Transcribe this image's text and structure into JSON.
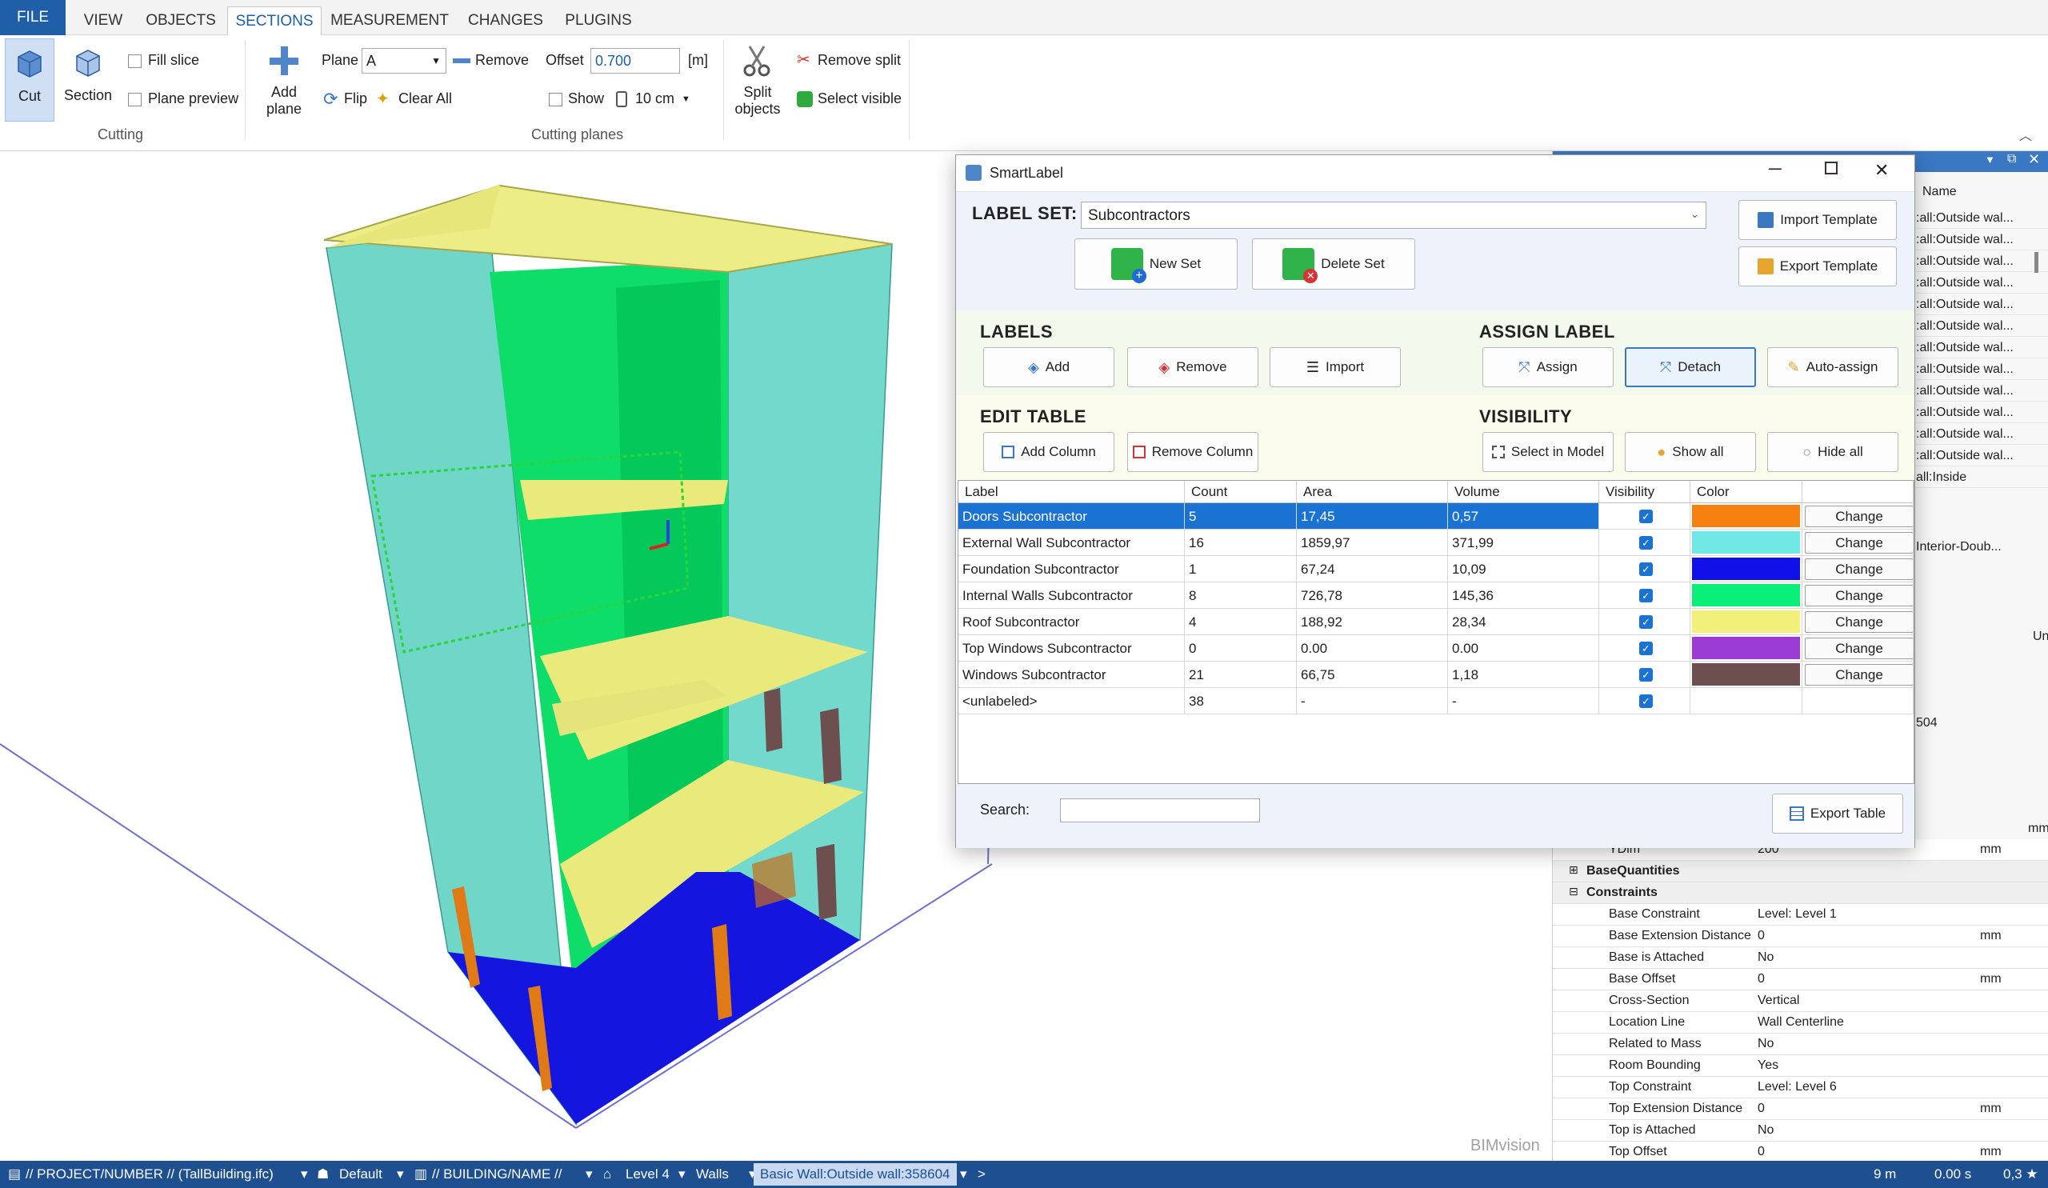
{
  "ribbon": {
    "tabs": [
      "FILE",
      "VIEW",
      "OBJECTS",
      "SECTIONS",
      "MEASUREMENT",
      "CHANGES",
      "PLUGINS"
    ],
    "active_tab": "SECTIONS",
    "cut_label": "Cut",
    "section_label": "Section",
    "fill_slice_label": "Fill slice",
    "plane_preview_label": "Plane preview",
    "cutting_group_label": "Cutting",
    "add_plane_label": "Add",
    "add_plane_label2": "plane",
    "plane_label": "Plane",
    "plane_value": "A",
    "remove_label": "Remove",
    "flip_label": "Flip",
    "clear_all_label": "Clear All",
    "offset_label": "Offset",
    "offset_value": "0.700",
    "offset_unit": "[m]",
    "show_label": "Show",
    "step_value": "10 cm",
    "cutting_planes_group_label": "Cutting planes",
    "split_objects_label": "Split",
    "split_objects_label2": "objects",
    "remove_split_label": "Remove split",
    "select_visible_label": "Select visible"
  },
  "viewport": {
    "watermark": "BIMvision"
  },
  "dock": {
    "name_header": "Name",
    "name_items": [
      ":all:Outside wal...",
      ":all:Outside wal...",
      ":all:Outside wal...",
      ":all:Outside wal...",
      ":all:Outside wal...",
      ":all:Outside wal...",
      ":all:Outside wal...",
      ":all:Outside wal...",
      ":all:Outside wal...",
      ":all:Outside wal...",
      ":all:Outside wal...",
      ":all:Outside wal...",
      "all:Inside"
    ],
    "interior_item": "Interior-Doub...",
    "unit_header": "Unit",
    "fragment_value": "504",
    "ydim_label": "YDim",
    "ydim_value": "200",
    "ydim_unit": "mm",
    "prev_unit": "mm",
    "base_quantities": "BaseQuantities",
    "constraints": "Constraints",
    "properties": [
      {
        "name": "Base Constraint",
        "value": "Level: Level 1",
        "unit": ""
      },
      {
        "name": "Base Extension Distance",
        "value": "0",
        "unit": "mm"
      },
      {
        "name": "Base is Attached",
        "value": "No",
        "unit": ""
      },
      {
        "name": "Base Offset",
        "value": "0",
        "unit": "mm"
      },
      {
        "name": "Cross-Section",
        "value": "Vertical",
        "unit": ""
      },
      {
        "name": "Location Line",
        "value": "Wall Centerline",
        "unit": ""
      },
      {
        "name": "Related to Mass",
        "value": "No",
        "unit": ""
      },
      {
        "name": "Room Bounding",
        "value": "Yes",
        "unit": ""
      },
      {
        "name": "Top Constraint",
        "value": "Level: Level 6",
        "unit": ""
      },
      {
        "name": "Top Extension Distance",
        "value": "0",
        "unit": "mm"
      },
      {
        "name": "Top is Attached",
        "value": "No",
        "unit": ""
      },
      {
        "name": "Top Offset",
        "value": "0",
        "unit": "mm"
      }
    ]
  },
  "dialog": {
    "title": "SmartLabel",
    "label_set_label": "LABEL SET:",
    "label_set_value": "Subcontractors",
    "import_template": "Import Template",
    "export_template": "Export Template",
    "new_set": "New Set",
    "delete_set": "Delete Set",
    "labels_header": "LABELS",
    "add": "Add",
    "remove": "Remove",
    "import": "Import",
    "assign_header": "ASSIGN LABEL",
    "assign": "Assign",
    "detach": "Detach",
    "auto_assign": "Auto-assign",
    "edit_table_header": "EDIT TABLE",
    "add_column": "Add Column",
    "remove_column": "Remove Column",
    "visibility_header": "VISIBILITY",
    "select_in_model": "Select in Model",
    "show_all": "Show all",
    "hide_all": "Hide all",
    "columns": [
      "Label",
      "Count",
      "Area",
      "Volume",
      "Visibility",
      "Color"
    ],
    "change_label": "Change",
    "rows": [
      {
        "label": "Doors Subcontractor",
        "count": "5",
        "area": "17,45",
        "volume": "0,57",
        "color": "#f57f0f",
        "selected": true
      },
      {
        "label": "External Wall Subcontractor",
        "count": "16",
        "area": "1859,97",
        "volume": "371,99",
        "color": "#6fe8e6",
        "selected": false
      },
      {
        "label": "Foundation Subcontractor",
        "count": "1",
        "area": "67,24",
        "volume": "10,09",
        "color": "#1010e8",
        "selected": false
      },
      {
        "label": "Internal Walls Subcontractor",
        "count": "8",
        "area": "726,78",
        "volume": "145,36",
        "color": "#0aef7a",
        "selected": false
      },
      {
        "label": "Roof Subcontractor",
        "count": "4",
        "area": "188,92",
        "volume": "28,34",
        "color": "#f2ef7a",
        "selected": false
      },
      {
        "label": "Top Windows Subcontractor",
        "count": "0",
        "area": "0.00",
        "volume": "0.00",
        "color": "#9b3bd6",
        "selected": false
      },
      {
        "label": "Windows Subcontractor",
        "count": "21",
        "area": "66,75",
        "volume": "1,18",
        "color": "#6e4f4f",
        "selected": false
      },
      {
        "label": "<unlabeled>",
        "count": "38",
        "area": "-",
        "volume": "-",
        "color": "",
        "selected": false
      }
    ],
    "search_label": "Search:",
    "search_value": "",
    "export_table": "Export Table"
  },
  "statusbar": {
    "project": "// PROJECT/NUMBER // (TallBuilding.ifc)",
    "view": "Default",
    "building": "// BUILDING/NAME //",
    "level": "Level 4",
    "category": "Walls",
    "selection": "Basic Wall:Outside wall:358604",
    "more": ">",
    "distance": "9 m",
    "time": "0.00 s",
    "fps": "0,3 ★"
  },
  "colors": {
    "accent": "#1e5fa8",
    "selection": "#1a73d2",
    "statusbar": "#1d4f91"
  }
}
